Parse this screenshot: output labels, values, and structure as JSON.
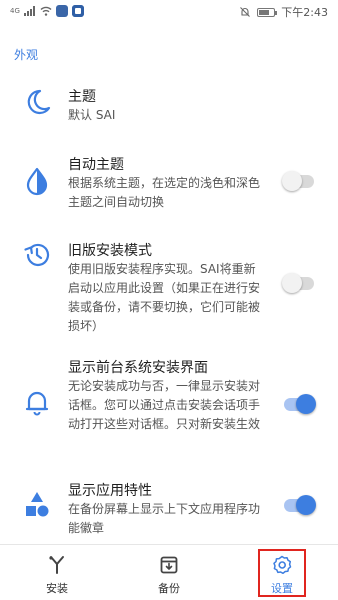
{
  "status_bar": {
    "signal_text": "4G",
    "time": "下午2:43",
    "battery_level": 0.7
  },
  "section": {
    "title": "外观"
  },
  "settings": [
    {
      "icon": "moon-icon",
      "title": "主题",
      "description": "默认 SAI"
    },
    {
      "icon": "contrast-drop-icon",
      "title": "自动主题",
      "description": "根据系统主题，在选定的浅色和深色主题之间自动切换",
      "toggle": false
    },
    {
      "icon": "history-icon",
      "title": "旧版安装模式",
      "description": "使用旧版安装程序实现。SAI将重新启动以应用此设置（如果正在进行安装或备份，请不要切换，它们可能被损坏）",
      "toggle": false
    },
    {
      "icon": "bell-icon",
      "title": "显示前台系统安装界面",
      "description": "无论安装成功与否，一律显示安装对话框。您可以通过点击安装会话项手动打开这些对话框。只对新安装生效",
      "toggle": true
    },
    {
      "icon": "shapes-icon",
      "title": "显示应用特性",
      "description": "在备份屏幕上显示上下文应用程序功能徽章",
      "toggle": true
    }
  ],
  "bottom_nav": [
    {
      "icon": "install-icon",
      "label": "安装"
    },
    {
      "icon": "backup-icon",
      "label": "备份"
    },
    {
      "icon": "gear-icon",
      "label": "设置",
      "active": true
    }
  ],
  "colors": {
    "accent": "#3d7ee0",
    "highlight": "#e0251f"
  }
}
